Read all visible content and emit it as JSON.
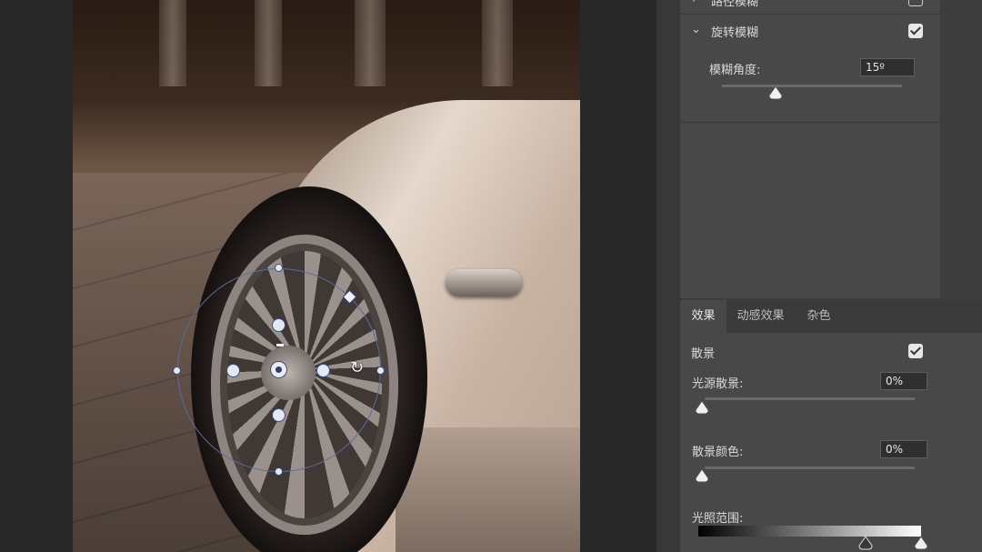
{
  "blur_panel": {
    "field_blur_label": "路径模糊",
    "field_blur_checked": false,
    "spin_blur_label": "旋转模糊",
    "spin_blur_checked": true,
    "blur_angle_label": "模糊角度:",
    "blur_angle_value": "15º",
    "blur_angle_percent": 30
  },
  "effects_panel": {
    "tabs": [
      {
        "label": "效果",
        "active": true
      },
      {
        "label": "动感效果",
        "active": false
      },
      {
        "label": "杂色",
        "active": false
      }
    ],
    "bokeh_label": "散景",
    "bokeh_checked": true,
    "light_bokeh_label": "光源散景:",
    "light_bokeh_value": "0%",
    "bokeh_color_label": "散景颜色:",
    "bokeh_color_value": "0%",
    "light_range_label": "光照范围:",
    "light_range_low": 191,
    "light_range_high": 255
  },
  "icons": {
    "expand_icon": "chevron-right-icon",
    "collapse_icon": "chevron-down-icon",
    "rotate_cursor": "rotate-cursor-icon"
  },
  "colors": {
    "panel_bg": "#484848",
    "canvas_bg": "#282828",
    "overlay_ring": "#5a6b99"
  }
}
